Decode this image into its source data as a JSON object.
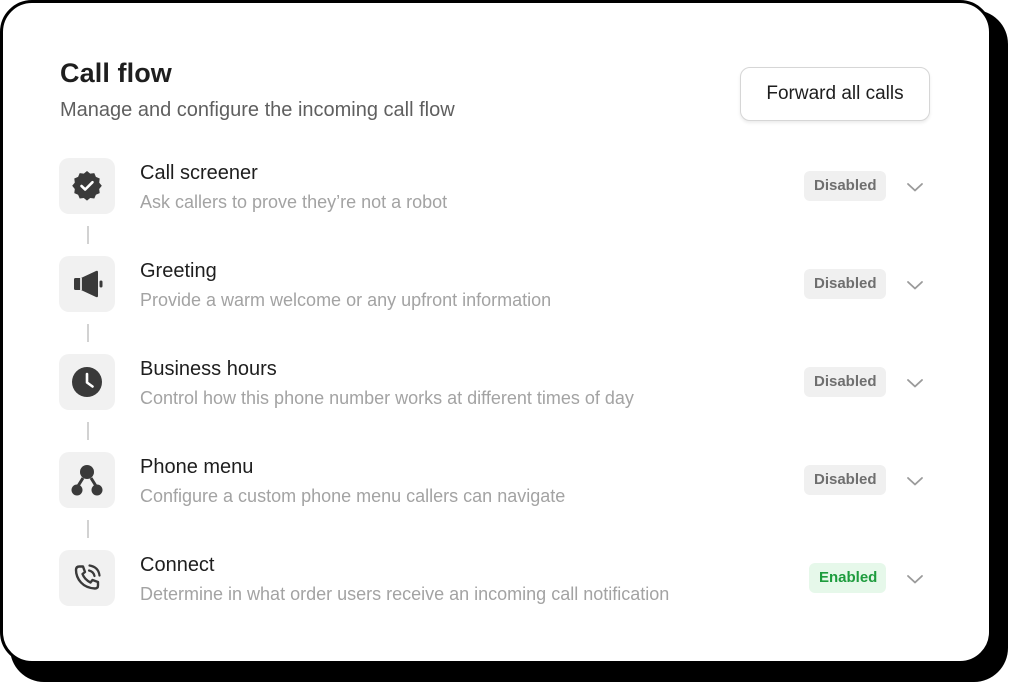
{
  "header": {
    "title": "Call flow",
    "subtitle": "Manage and configure the incoming call flow",
    "forward_button_label": "Forward all calls"
  },
  "steps": [
    {
      "icon": "verified-badge-icon",
      "title": "Call screener",
      "description": "Ask callers to prove they’re not a robot",
      "status": "Disabled"
    },
    {
      "icon": "megaphone-icon",
      "title": "Greeting",
      "description": "Provide a warm welcome or any upfront information",
      "status": "Disabled"
    },
    {
      "icon": "clock-icon",
      "title": "Business hours",
      "description": "Control how this phone number works at different times of day",
      "status": "Disabled"
    },
    {
      "icon": "phone-menu-icon",
      "title": "Phone menu",
      "description": "Configure a custom phone menu callers can navigate",
      "status": "Disabled"
    },
    {
      "icon": "phone-ringing-icon",
      "title": "Connect",
      "description": "Determine in what order users receive an incoming call notification",
      "status": "Enabled"
    }
  ],
  "colors": {
    "enabled_badge_bg": "#e6f8ea",
    "enabled_badge_text": "#1e9c3e",
    "disabled_badge_bg": "#f0f0f0",
    "disabled_badge_text": "#6f6f6f",
    "icon_color": "#3a3a3a"
  }
}
